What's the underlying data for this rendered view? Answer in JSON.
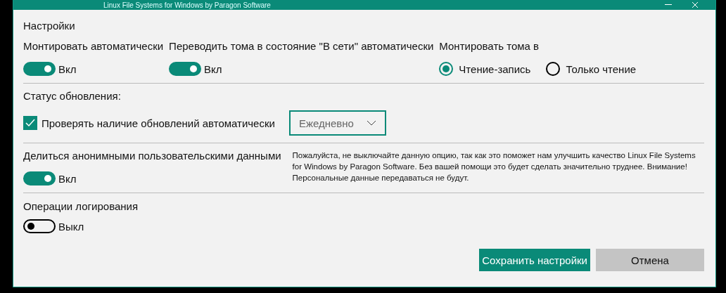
{
  "window": {
    "title": "Linux File Systems for Windows by Paragon Software"
  },
  "settings": {
    "heading": "Настройки",
    "columns": [
      {
        "kind": "toggle",
        "label": "Монтировать автоматически",
        "on": true,
        "state_label": "Вкл"
      },
      {
        "kind": "toggle",
        "label": "Переводить тома в состояние \"В сети\" автоматически",
        "on": true,
        "state_label": "Вкл"
      },
      {
        "kind": "radio",
        "label": "Монтировать тома в",
        "options": [
          {
            "label": "Чтение-запись",
            "selected": true
          },
          {
            "label": "Только чтение",
            "selected": false
          }
        ]
      }
    ]
  },
  "updates": {
    "heading": "Статус обновления:",
    "checkbox": {
      "label": "Проверять наличие обновлений автоматически",
      "checked": true
    },
    "frequency": {
      "value": "Ежедневно"
    }
  },
  "share": {
    "label": "Делиться анонимными пользовательскими данными",
    "on": true,
    "state_label": "Вкл",
    "note": "Пожалуйста, не выключайте данную опцию, так как это поможет нам улучшить качество Linux File Systems for Windows by Paragon Software. Без вашей помощи это будет сделать значительно труднее. Внимание! Персональные данные передаваться не будут."
  },
  "logging": {
    "label": "Операции логирования",
    "on": false,
    "state_label": "Выкл"
  },
  "buttons": [
    {
      "kind": "primary",
      "label": "Сохранить настройки"
    },
    {
      "kind": "secondary",
      "label": "Отмена"
    }
  ]
}
